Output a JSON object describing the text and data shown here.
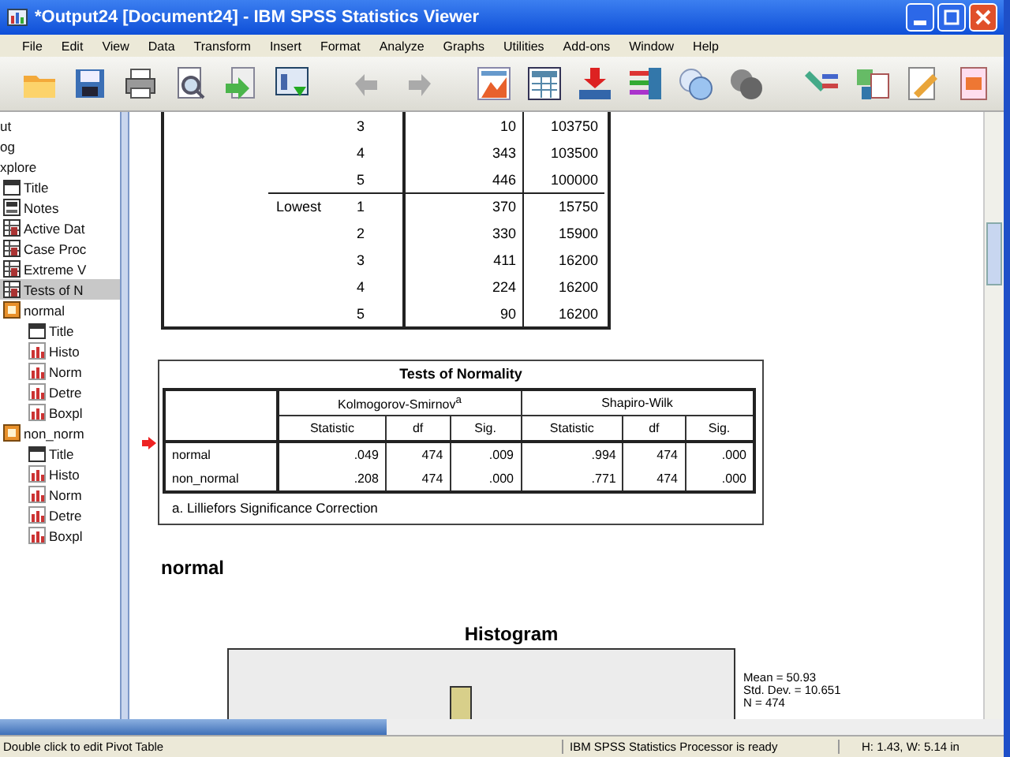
{
  "window": {
    "title": "*Output24 [Document24] - IBM SPSS Statistics Viewer"
  },
  "menu": [
    "File",
    "Edit",
    "View",
    "Data",
    "Transform",
    "Insert",
    "Format",
    "Analyze",
    "Graphs",
    "Utilities",
    "Add-ons",
    "Window",
    "Help"
  ],
  "outline": {
    "items": [
      {
        "label": "ut",
        "selected": false
      },
      {
        "label": "og",
        "selected": false
      },
      {
        "label": "xplore",
        "selected": false,
        "children": [
          {
            "label": "Title",
            "kind": "title",
            "selected": false
          },
          {
            "label": "Notes",
            "kind": "notes",
            "selected": false
          },
          {
            "label": "Active Dat",
            "kind": "table",
            "selected": false
          },
          {
            "label": "Case Proc",
            "kind": "table",
            "selected": false
          },
          {
            "label": "Extreme V",
            "kind": "table",
            "selected": false
          },
          {
            "label": "Tests of N",
            "kind": "table",
            "selected": true
          },
          {
            "label": "normal",
            "kind": "heading",
            "selected": false,
            "children": [
              {
                "label": "Title",
                "kind": "title",
                "selected": false
              },
              {
                "label": "Histo",
                "kind": "chart",
                "selected": false
              },
              {
                "label": "Norm",
                "kind": "chart",
                "selected": false
              },
              {
                "label": "Detre",
                "kind": "chart",
                "selected": false
              },
              {
                "label": "Boxpl",
                "kind": "chart",
                "selected": false
              }
            ]
          },
          {
            "label": "non_norm",
            "kind": "heading",
            "selected": false,
            "children": [
              {
                "label": "Title",
                "kind": "title",
                "selected": false
              },
              {
                "label": "Histo",
                "kind": "chart",
                "selected": false
              },
              {
                "label": "Norm",
                "kind": "chart",
                "selected": false
              },
              {
                "label": "Detre",
                "kind": "chart",
                "selected": false
              },
              {
                "label": "Boxpl",
                "kind": "chart",
                "selected": false
              }
            ]
          }
        ]
      }
    ]
  },
  "extreme_values": {
    "rows": [
      {
        "rank": "3",
        "case": "10",
        "value": "103750"
      },
      {
        "rank": "4",
        "case": "343",
        "value": "103500"
      },
      {
        "rank": "5",
        "case": "446",
        "value": "100000"
      },
      {
        "group": "Lowest",
        "rank": "1",
        "case": "370",
        "value": "15750"
      },
      {
        "rank": "2",
        "case": "330",
        "value": "15900"
      },
      {
        "rank": "3",
        "case": "411",
        "value": "16200"
      },
      {
        "rank": "4",
        "case": "224",
        "value": "16200"
      },
      {
        "rank": "5",
        "case": "90",
        "value": "16200"
      }
    ]
  },
  "normality_table": {
    "title": "Tests of Normality",
    "current": true,
    "group_headers": [
      "Kolmogorov-Smirnov$^{a}$",
      "Shapiro-Wilk"
    ],
    "columns": [
      "Statistic",
      "df",
      "Sig.",
      "Statistic",
      "df",
      "Sig."
    ],
    "rows": [
      {
        "label": "normal",
        "cells": [
          ".049",
          "474",
          ".009",
          ".994",
          "474",
          ".000"
        ]
      },
      {
        "label": "non_normal",
        "cells": [
          ".208",
          "474",
          ".000",
          ".771",
          "474",
          ".000"
        ]
      }
    ],
    "footnote": "a. Lilliefors Significance Correction"
  },
  "section_heading": "normal",
  "histogram": {
    "title": "Histogram",
    "legend": [
      "Mean = 50.93",
      "Std. Dev. = 10.651",
      "N = 474"
    ]
  },
  "status_bar": [
    "Double click to edit Pivot Table",
    "IBM SPSS Statistics Processor is ready",
    "H: 1.43, W: 5.14 in"
  ]
}
